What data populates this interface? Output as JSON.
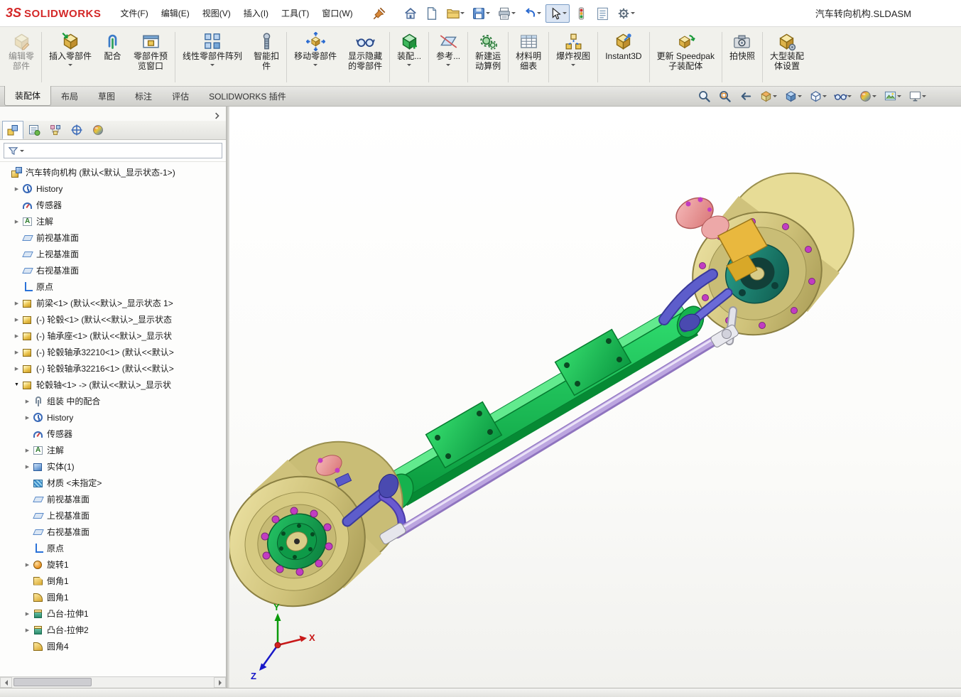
{
  "brand": {
    "mark": "3S",
    "name": "SOLIDWORKS"
  },
  "window": {
    "title": "汽车转向机构.SLDASM"
  },
  "menubar": {
    "items": [
      "文件(F)",
      "编辑(E)",
      "视图(V)",
      "插入(I)",
      "工具(T)",
      "窗口(W)"
    ]
  },
  "topbar": {
    "tools": [
      {
        "name": "pin-icon"
      },
      {
        "name": "home-icon"
      },
      {
        "name": "new-document-icon"
      },
      {
        "name": "open-icon",
        "dropdown": true
      },
      {
        "name": "save-icon",
        "dropdown": true
      },
      {
        "name": "print-icon",
        "dropdown": true
      },
      {
        "name": "undo-icon",
        "dropdown": true
      },
      {
        "name": "select-cursor-icon",
        "dropdown": true,
        "pressed": true
      },
      {
        "name": "rebuild-icon"
      },
      {
        "name": "file-properties-icon"
      },
      {
        "name": "settings-icon",
        "dropdown": true
      }
    ]
  },
  "ribbon": {
    "buttons": [
      {
        "icon": "edit-component-icon",
        "label": "编辑零\n部件",
        "disabled": true
      },
      {
        "icon": "insert-component-icon",
        "label": "插入零部件",
        "dropdown": true
      },
      {
        "icon": "mate-icon",
        "label": "配合"
      },
      {
        "icon": "component-preview-icon",
        "label": "零部件预\n览窗口"
      },
      {
        "icon": "linear-pattern-icon",
        "label": "线性零部件阵列",
        "dropdown": true
      },
      {
        "icon": "smart-fasteners-icon",
        "label": "智能扣\n件"
      },
      {
        "icon": "move-component-icon",
        "label": "移动零部件",
        "dropdown": true
      },
      {
        "icon": "show-hidden-icon",
        "label": "显示隐藏\n的零部件"
      },
      {
        "icon": "assembly-features-icon",
        "label": "装配...",
        "dropdown": true
      },
      {
        "icon": "reference-geometry-icon",
        "label": "参考...",
        "dropdown": true
      },
      {
        "icon": "motion-study-icon",
        "label": "新建运\n动算例"
      },
      {
        "icon": "bom-icon",
        "label": "材料明\n细表"
      },
      {
        "icon": "exploded-view-icon",
        "label": "爆炸视图",
        "dropdown": true
      },
      {
        "icon": "instant3d-icon",
        "label": "Instant3D"
      },
      {
        "icon": "speedpak-icon",
        "label": "更新 Speedpak\n子装配体"
      },
      {
        "icon": "snapshot-icon",
        "label": "拍快照"
      },
      {
        "icon": "large-assembly-icon",
        "label": "大型装配\n体设置"
      }
    ]
  },
  "tabs": {
    "items": [
      {
        "label": "装配体",
        "active": true
      },
      {
        "label": "布局"
      },
      {
        "label": "草图"
      },
      {
        "label": "标注"
      },
      {
        "label": "评估"
      },
      {
        "label": "SOLIDWORKS 插件"
      }
    ]
  },
  "viewtoolbar": {
    "tools": [
      {
        "name": "zoom-fit-icon"
      },
      {
        "name": "zoom-area-icon"
      },
      {
        "name": "previous-view-icon"
      },
      {
        "name": "section-view-icon",
        "dropdown": true
      },
      {
        "name": "view-orientation-icon",
        "dropdown": true
      },
      {
        "name": "display-style-icon",
        "dropdown": true
      },
      {
        "name": "hide-show-items-icon",
        "dropdown": true
      },
      {
        "name": "edit-appearance-icon",
        "dropdown": true
      },
      {
        "name": "apply-scene-icon",
        "dropdown": true
      },
      {
        "name": "view-settings-icon",
        "dropdown": true
      }
    ]
  },
  "panel": {
    "tabs": [
      {
        "name": "featuremanager-icon",
        "active": true
      },
      {
        "name": "propertymanager-icon"
      },
      {
        "name": "configurationmanager-icon"
      },
      {
        "name": "dimxpertmanager-icon"
      },
      {
        "name": "displaymanager-icon"
      }
    ],
    "tree": [
      {
        "label": "汽车转向机构 (默认<默认_显示状态-1>)",
        "icon": "assembly",
        "indent": 0,
        "arrow": "none"
      },
      {
        "label": "History",
        "icon": "history",
        "indent": 1,
        "arrow": "right"
      },
      {
        "label": "传感器",
        "icon": "sensor",
        "indent": 1,
        "arrow": "none"
      },
      {
        "label": "注解",
        "icon": "annotations",
        "indent": 1,
        "arrow": "right"
      },
      {
        "label": "前视基准面",
        "icon": "plane",
        "indent": 1,
        "arrow": "none"
      },
      {
        "label": "上视基准面",
        "icon": "plane",
        "indent": 1,
        "arrow": "none"
      },
      {
        "label": "右视基准面",
        "icon": "plane",
        "indent": 1,
        "arrow": "none"
      },
      {
        "label": "原点",
        "icon": "origin",
        "indent": 1,
        "arrow": "none"
      },
      {
        "label": "前梁<1> (默认<<默认>_显示状态 1>",
        "icon": "part",
        "indent": 1,
        "arrow": "right"
      },
      {
        "label": "(-) 轮毂<1> (默认<<默认>_显示状态",
        "icon": "part",
        "indent": 1,
        "arrow": "right"
      },
      {
        "label": "(-) 轴承座<1> (默认<<默认>_显示状",
        "icon": "part",
        "indent": 1,
        "arrow": "right"
      },
      {
        "label": "(-) 轮毂轴承32210<1> (默认<<默认>",
        "icon": "part",
        "indent": 1,
        "arrow": "right"
      },
      {
        "label": "(-) 轮毂轴承32216<1> (默认<<默认>",
        "icon": "part",
        "indent": 1,
        "arrow": "right"
      },
      {
        "label": "轮毂轴<1> -> (默认<<默认>_显示状",
        "icon": "part",
        "indent": 1,
        "arrow": "down"
      },
      {
        "label": "组装 中的配合",
        "icon": "mates",
        "indent": 2,
        "arrow": "right"
      },
      {
        "label": "History",
        "icon": "history",
        "indent": 2,
        "arrow": "right"
      },
      {
        "label": "传感器",
        "icon": "sensor",
        "indent": 2,
        "arrow": "none"
      },
      {
        "label": "注解",
        "icon": "annotations",
        "indent": 2,
        "arrow": "right"
      },
      {
        "label": "实体(1)",
        "icon": "solids",
        "indent": 2,
        "arrow": "right"
      },
      {
        "label": "材质 <未指定>",
        "icon": "material",
        "indent": 2,
        "arrow": "none"
      },
      {
        "label": "前视基准面",
        "icon": "plane",
        "indent": 2,
        "arrow": "none"
      },
      {
        "label": "上视基准面",
        "icon": "plane",
        "indent": 2,
        "arrow": "none"
      },
      {
        "label": "右视基准面",
        "icon": "plane",
        "indent": 2,
        "arrow": "none"
      },
      {
        "label": "原点",
        "icon": "origin",
        "indent": 2,
        "arrow": "none"
      },
      {
        "label": "旋转1",
        "icon": "revolve",
        "indent": 2,
        "arrow": "right"
      },
      {
        "label": "倒角1",
        "icon": "chamfer",
        "indent": 2,
        "arrow": "none"
      },
      {
        "label": "圆角1",
        "icon": "fillet",
        "indent": 2,
        "arrow": "none"
      },
      {
        "label": "凸台-拉伸1",
        "icon": "extrude",
        "indent": 2,
        "arrow": "right"
      },
      {
        "label": "凸台-拉伸2",
        "icon": "extrude",
        "indent": 2,
        "arrow": "right"
      },
      {
        "label": "圆角4",
        "icon": "fillet",
        "indent": 2,
        "arrow": "none"
      }
    ]
  },
  "viewport": {
    "triad": {
      "x": "X",
      "y": "Y",
      "z": "Z"
    }
  },
  "statusbar": {
    "text": ""
  }
}
